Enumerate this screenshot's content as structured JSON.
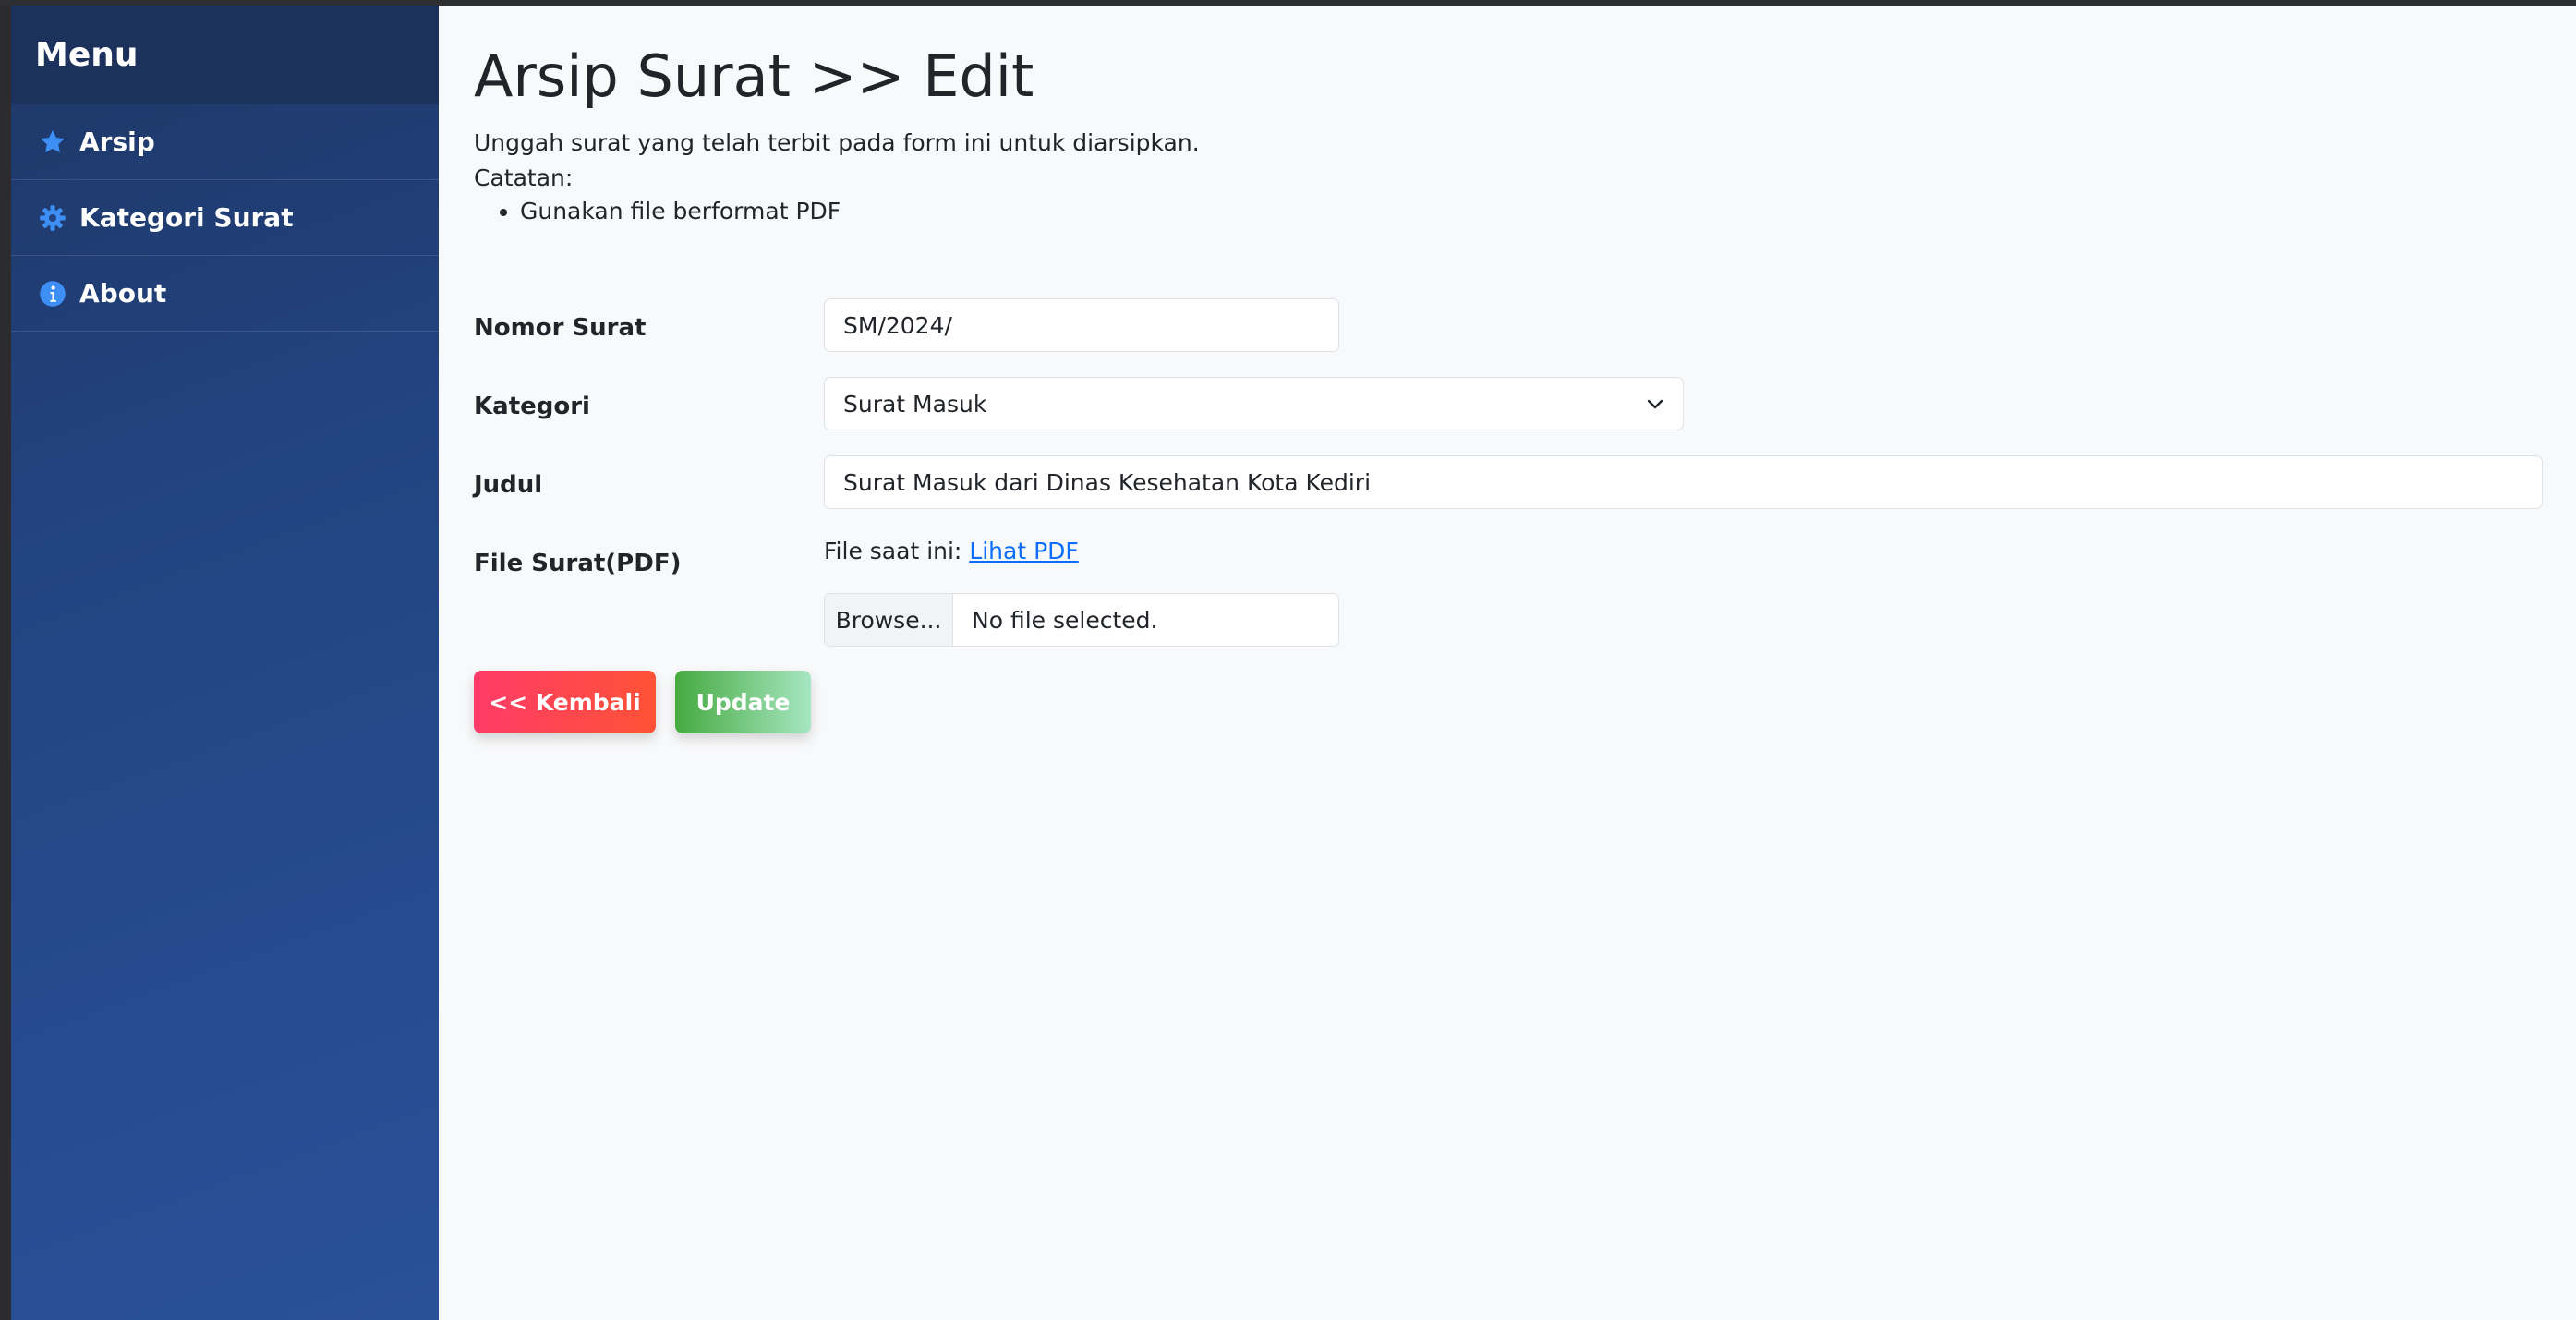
{
  "sidebar": {
    "title": "Menu",
    "items": [
      {
        "label": "Arsip",
        "icon": "star-icon"
      },
      {
        "label": "Kategori Surat",
        "icon": "gear-icon"
      },
      {
        "label": "About",
        "icon": "info-icon"
      }
    ]
  },
  "page": {
    "title": "Arsip Surat >> Edit",
    "description": "Unggah surat yang telah terbit pada form ini untuk diarsipkan.",
    "notes_label": "Catatan:",
    "notes": [
      "Gunakan file berformat PDF"
    ]
  },
  "form": {
    "nomor_label": "Nomor Surat",
    "nomor_value": "SM/2024/",
    "kategori_label": "Kategori",
    "kategori_value": "Surat Masuk",
    "judul_label": "Judul",
    "judul_value": "Surat Masuk dari Dinas Kesehatan Kota Kediri",
    "file_label": "File Surat(PDF)",
    "file_current_prefix": "File saat ini:",
    "file_link": "Lihat PDF",
    "browse_label": "Browse...",
    "no_file_text": "No file selected."
  },
  "buttons": {
    "back_label": "<< Kembali",
    "update_label": "Update"
  },
  "colors": {
    "sidebar_header": "#1c325c",
    "icon_blue": "#3d8ff5",
    "back_button": "#ff3b68",
    "update_button": "#46aa3f",
    "link": "#0d6efd"
  }
}
